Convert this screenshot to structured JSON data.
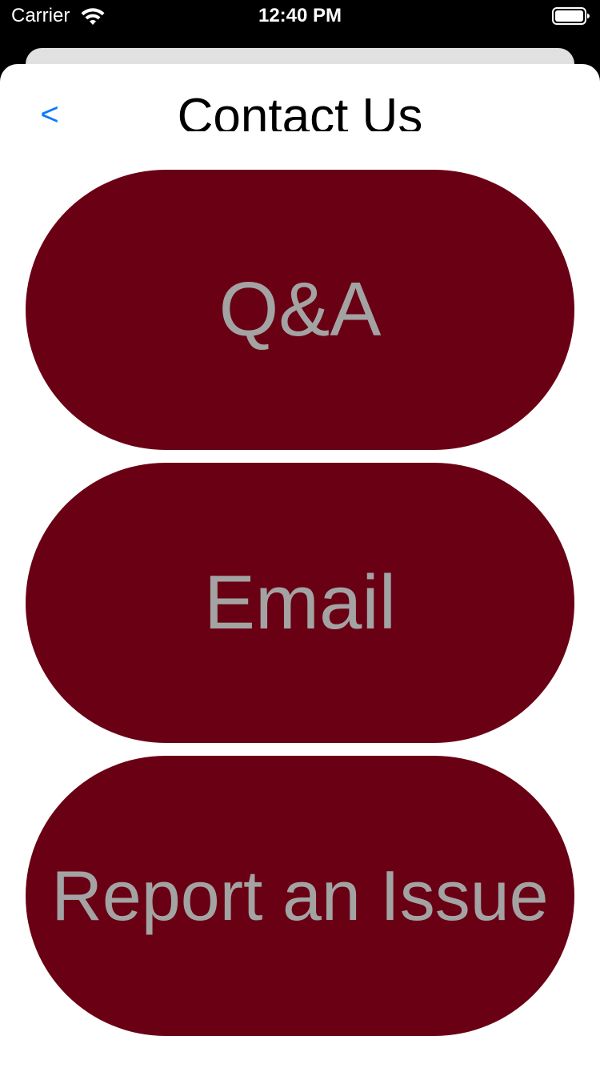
{
  "status_bar": {
    "carrier": "Carrier",
    "time": "12:40 PM",
    "wifi_icon": "wifi-icon",
    "battery_icon": "battery-full-icon"
  },
  "nav": {
    "back_label": "<",
    "title": "Contact Us"
  },
  "actions": {
    "qa_label": "Q&A",
    "email_label": "Email",
    "report_label": "Report an Issue"
  },
  "colors": {
    "button_background": "#6a0014",
    "button_text": "#a3a3a3",
    "back_link": "#0a7aff",
    "sheet_background": "#ffffff"
  }
}
